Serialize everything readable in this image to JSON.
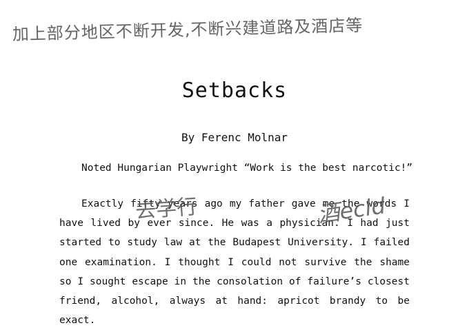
{
  "document": {
    "handwritten_top": "加上部分地区不断开发,不断兴建道路及酒店等",
    "title": "Setbacks",
    "byline": "By Ferenc Molnar",
    "subtitle": "Noted Hungarian Playwright “Work is the best narcotic!”",
    "paragraph": "Exactly fifty years ago my father gave me the words I have lived by ever since. He was a physician. I had just started to study law at the Budapest University. I failed one examination. I thought I could not survive the shame so I sought escape in the consolation of failure’s closest friend, alcohol, always at hand: apricot brandy to be exact.",
    "handwritten_notes": [
      "去学行",
      "酒ecld"
    ]
  }
}
